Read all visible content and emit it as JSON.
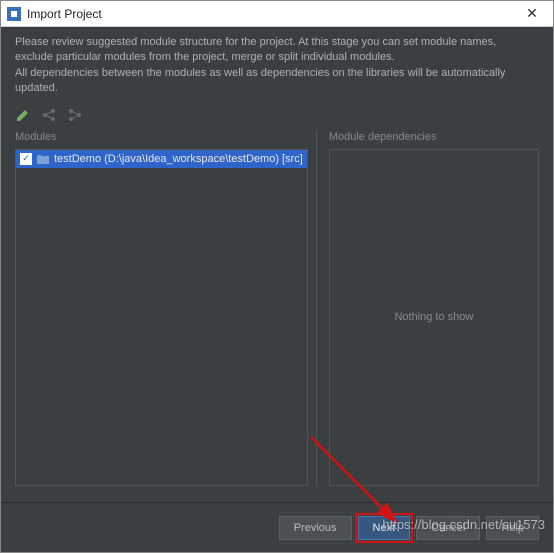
{
  "window": {
    "title": "Import Project"
  },
  "instructions": {
    "line1": "Please review suggested module structure for the project. At this stage you can set module names,",
    "line2": "exclude particular modules from the project, merge or split individual modules.",
    "line3": "All dependencies between the modules as well as dependencies on the libraries will be automatically updated."
  },
  "panes": {
    "modules_header": "Modules",
    "deps_header": "Module dependencies",
    "empty_text": "Nothing to show"
  },
  "modules": [
    {
      "checked": true,
      "label": "testDemo (D:\\java\\Idea_workspace\\testDemo) [src]"
    }
  ],
  "footer": {
    "previous": "Previous",
    "next": "Next",
    "cancel": "Cancel",
    "help": "Help"
  },
  "watermark": "https://blog.csdn.net/su1573"
}
